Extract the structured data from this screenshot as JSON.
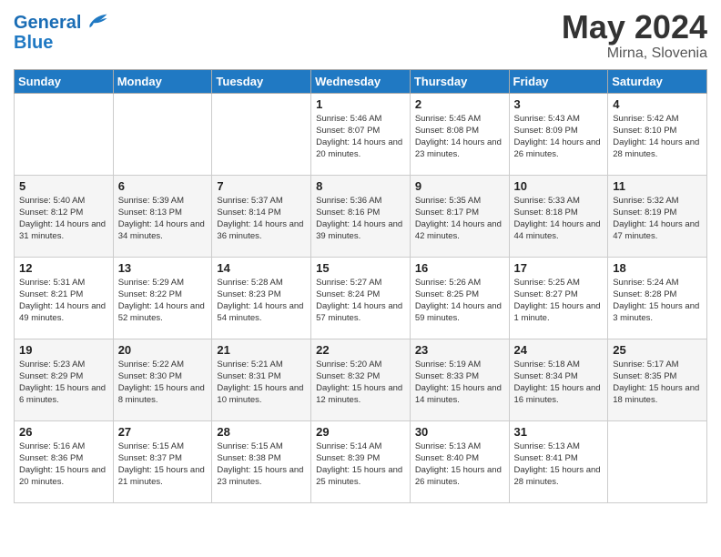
{
  "header": {
    "logo_line1": "General",
    "logo_line2": "Blue",
    "month_year": "May 2024",
    "location": "Mirna, Slovenia"
  },
  "days_of_week": [
    "Sunday",
    "Monday",
    "Tuesday",
    "Wednesday",
    "Thursday",
    "Friday",
    "Saturday"
  ],
  "weeks": [
    [
      {
        "day": "",
        "sunrise": "",
        "sunset": "",
        "daylight": ""
      },
      {
        "day": "",
        "sunrise": "",
        "sunset": "",
        "daylight": ""
      },
      {
        "day": "",
        "sunrise": "",
        "sunset": "",
        "daylight": ""
      },
      {
        "day": "1",
        "sunrise": "Sunrise: 5:46 AM",
        "sunset": "Sunset: 8:07 PM",
        "daylight": "Daylight: 14 hours and 20 minutes."
      },
      {
        "day": "2",
        "sunrise": "Sunrise: 5:45 AM",
        "sunset": "Sunset: 8:08 PM",
        "daylight": "Daylight: 14 hours and 23 minutes."
      },
      {
        "day": "3",
        "sunrise": "Sunrise: 5:43 AM",
        "sunset": "Sunset: 8:09 PM",
        "daylight": "Daylight: 14 hours and 26 minutes."
      },
      {
        "day": "4",
        "sunrise": "Sunrise: 5:42 AM",
        "sunset": "Sunset: 8:10 PM",
        "daylight": "Daylight: 14 hours and 28 minutes."
      }
    ],
    [
      {
        "day": "5",
        "sunrise": "Sunrise: 5:40 AM",
        "sunset": "Sunset: 8:12 PM",
        "daylight": "Daylight: 14 hours and 31 minutes."
      },
      {
        "day": "6",
        "sunrise": "Sunrise: 5:39 AM",
        "sunset": "Sunset: 8:13 PM",
        "daylight": "Daylight: 14 hours and 34 minutes."
      },
      {
        "day": "7",
        "sunrise": "Sunrise: 5:37 AM",
        "sunset": "Sunset: 8:14 PM",
        "daylight": "Daylight: 14 hours and 36 minutes."
      },
      {
        "day": "8",
        "sunrise": "Sunrise: 5:36 AM",
        "sunset": "Sunset: 8:16 PM",
        "daylight": "Daylight: 14 hours and 39 minutes."
      },
      {
        "day": "9",
        "sunrise": "Sunrise: 5:35 AM",
        "sunset": "Sunset: 8:17 PM",
        "daylight": "Daylight: 14 hours and 42 minutes."
      },
      {
        "day": "10",
        "sunrise": "Sunrise: 5:33 AM",
        "sunset": "Sunset: 8:18 PM",
        "daylight": "Daylight: 14 hours and 44 minutes."
      },
      {
        "day": "11",
        "sunrise": "Sunrise: 5:32 AM",
        "sunset": "Sunset: 8:19 PM",
        "daylight": "Daylight: 14 hours and 47 minutes."
      }
    ],
    [
      {
        "day": "12",
        "sunrise": "Sunrise: 5:31 AM",
        "sunset": "Sunset: 8:21 PM",
        "daylight": "Daylight: 14 hours and 49 minutes."
      },
      {
        "day": "13",
        "sunrise": "Sunrise: 5:29 AM",
        "sunset": "Sunset: 8:22 PM",
        "daylight": "Daylight: 14 hours and 52 minutes."
      },
      {
        "day": "14",
        "sunrise": "Sunrise: 5:28 AM",
        "sunset": "Sunset: 8:23 PM",
        "daylight": "Daylight: 14 hours and 54 minutes."
      },
      {
        "day": "15",
        "sunrise": "Sunrise: 5:27 AM",
        "sunset": "Sunset: 8:24 PM",
        "daylight": "Daylight: 14 hours and 57 minutes."
      },
      {
        "day": "16",
        "sunrise": "Sunrise: 5:26 AM",
        "sunset": "Sunset: 8:25 PM",
        "daylight": "Daylight: 14 hours and 59 minutes."
      },
      {
        "day": "17",
        "sunrise": "Sunrise: 5:25 AM",
        "sunset": "Sunset: 8:27 PM",
        "daylight": "Daylight: 15 hours and 1 minute."
      },
      {
        "day": "18",
        "sunrise": "Sunrise: 5:24 AM",
        "sunset": "Sunset: 8:28 PM",
        "daylight": "Daylight: 15 hours and 3 minutes."
      }
    ],
    [
      {
        "day": "19",
        "sunrise": "Sunrise: 5:23 AM",
        "sunset": "Sunset: 8:29 PM",
        "daylight": "Daylight: 15 hours and 6 minutes."
      },
      {
        "day": "20",
        "sunrise": "Sunrise: 5:22 AM",
        "sunset": "Sunset: 8:30 PM",
        "daylight": "Daylight: 15 hours and 8 minutes."
      },
      {
        "day": "21",
        "sunrise": "Sunrise: 5:21 AM",
        "sunset": "Sunset: 8:31 PM",
        "daylight": "Daylight: 15 hours and 10 minutes."
      },
      {
        "day": "22",
        "sunrise": "Sunrise: 5:20 AM",
        "sunset": "Sunset: 8:32 PM",
        "daylight": "Daylight: 15 hours and 12 minutes."
      },
      {
        "day": "23",
        "sunrise": "Sunrise: 5:19 AM",
        "sunset": "Sunset: 8:33 PM",
        "daylight": "Daylight: 15 hours and 14 minutes."
      },
      {
        "day": "24",
        "sunrise": "Sunrise: 5:18 AM",
        "sunset": "Sunset: 8:34 PM",
        "daylight": "Daylight: 15 hours and 16 minutes."
      },
      {
        "day": "25",
        "sunrise": "Sunrise: 5:17 AM",
        "sunset": "Sunset: 8:35 PM",
        "daylight": "Daylight: 15 hours and 18 minutes."
      }
    ],
    [
      {
        "day": "26",
        "sunrise": "Sunrise: 5:16 AM",
        "sunset": "Sunset: 8:36 PM",
        "daylight": "Daylight: 15 hours and 20 minutes."
      },
      {
        "day": "27",
        "sunrise": "Sunrise: 5:15 AM",
        "sunset": "Sunset: 8:37 PM",
        "daylight": "Daylight: 15 hours and 21 minutes."
      },
      {
        "day": "28",
        "sunrise": "Sunrise: 5:15 AM",
        "sunset": "Sunset: 8:38 PM",
        "daylight": "Daylight: 15 hours and 23 minutes."
      },
      {
        "day": "29",
        "sunrise": "Sunrise: 5:14 AM",
        "sunset": "Sunset: 8:39 PM",
        "daylight": "Daylight: 15 hours and 25 minutes."
      },
      {
        "day": "30",
        "sunrise": "Sunrise: 5:13 AM",
        "sunset": "Sunset: 8:40 PM",
        "daylight": "Daylight: 15 hours and 26 minutes."
      },
      {
        "day": "31",
        "sunrise": "Sunrise: 5:13 AM",
        "sunset": "Sunset: 8:41 PM",
        "daylight": "Daylight: 15 hours and 28 minutes."
      },
      {
        "day": "",
        "sunrise": "",
        "sunset": "",
        "daylight": ""
      }
    ]
  ]
}
